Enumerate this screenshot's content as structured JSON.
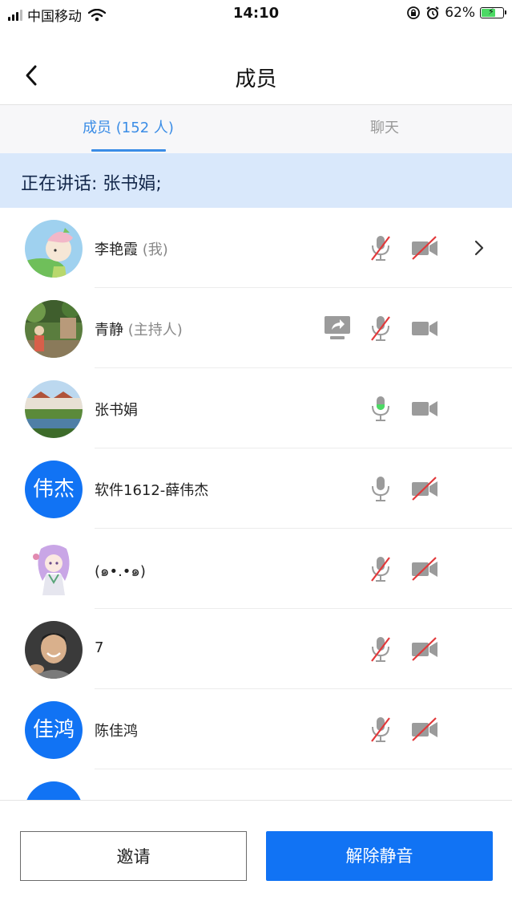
{
  "status_bar": {
    "carrier": "中国移动",
    "time": "14:10",
    "battery": "62%",
    "battery_level": 0.62
  },
  "nav": {
    "title": "成员",
    "back_icon": "chevron-left-icon"
  },
  "tabs": [
    {
      "label": "成员 (152 人)",
      "active": true
    },
    {
      "label": "聊天",
      "active": false
    }
  ],
  "speaking": {
    "text": "正在讲话: 张书娟;"
  },
  "members": [
    {
      "name": "李艳霞",
      "role": "(我)",
      "avatar": "illustrated-girl",
      "mic": "muted",
      "cam": "off",
      "share": false,
      "chevron": true
    },
    {
      "name": "青静",
      "role": "(主持人)",
      "avatar": "garden-photo",
      "mic": "muted",
      "cam": "on",
      "share": true,
      "chevron": false
    },
    {
      "name": "张书娟",
      "role": "",
      "avatar": "village-photo",
      "mic": "speaking",
      "cam": "on",
      "share": false,
      "chevron": false
    },
    {
      "name": "软件1612-薛伟杰",
      "role": "",
      "avatar_text": "伟杰",
      "mic": "on",
      "cam": "off",
      "share": false,
      "chevron": false
    },
    {
      "name": "(๑•.•๑)",
      "role": "",
      "avatar": "anime-character",
      "mic": "muted",
      "cam": "off",
      "share": false,
      "chevron": false
    },
    {
      "name": "7",
      "role": "",
      "avatar": "person-photo",
      "mic": "muted",
      "cam": "off",
      "share": false,
      "chevron": false
    },
    {
      "name": "陈佳鸿",
      "role": "",
      "avatar_text": "佳鸿",
      "mic": "muted",
      "cam": "off",
      "share": false,
      "chevron": false
    }
  ],
  "buttons": {
    "invite": "邀请",
    "unmute_all": "解除静音"
  },
  "colors": {
    "accent": "#1173f4",
    "tab_active": "#3b8de6",
    "banner_bg": "#d9e8fb",
    "speaking_green": "#4cd964",
    "mute_red": "#e2383a",
    "icon_gray": "#9b9b9b"
  }
}
